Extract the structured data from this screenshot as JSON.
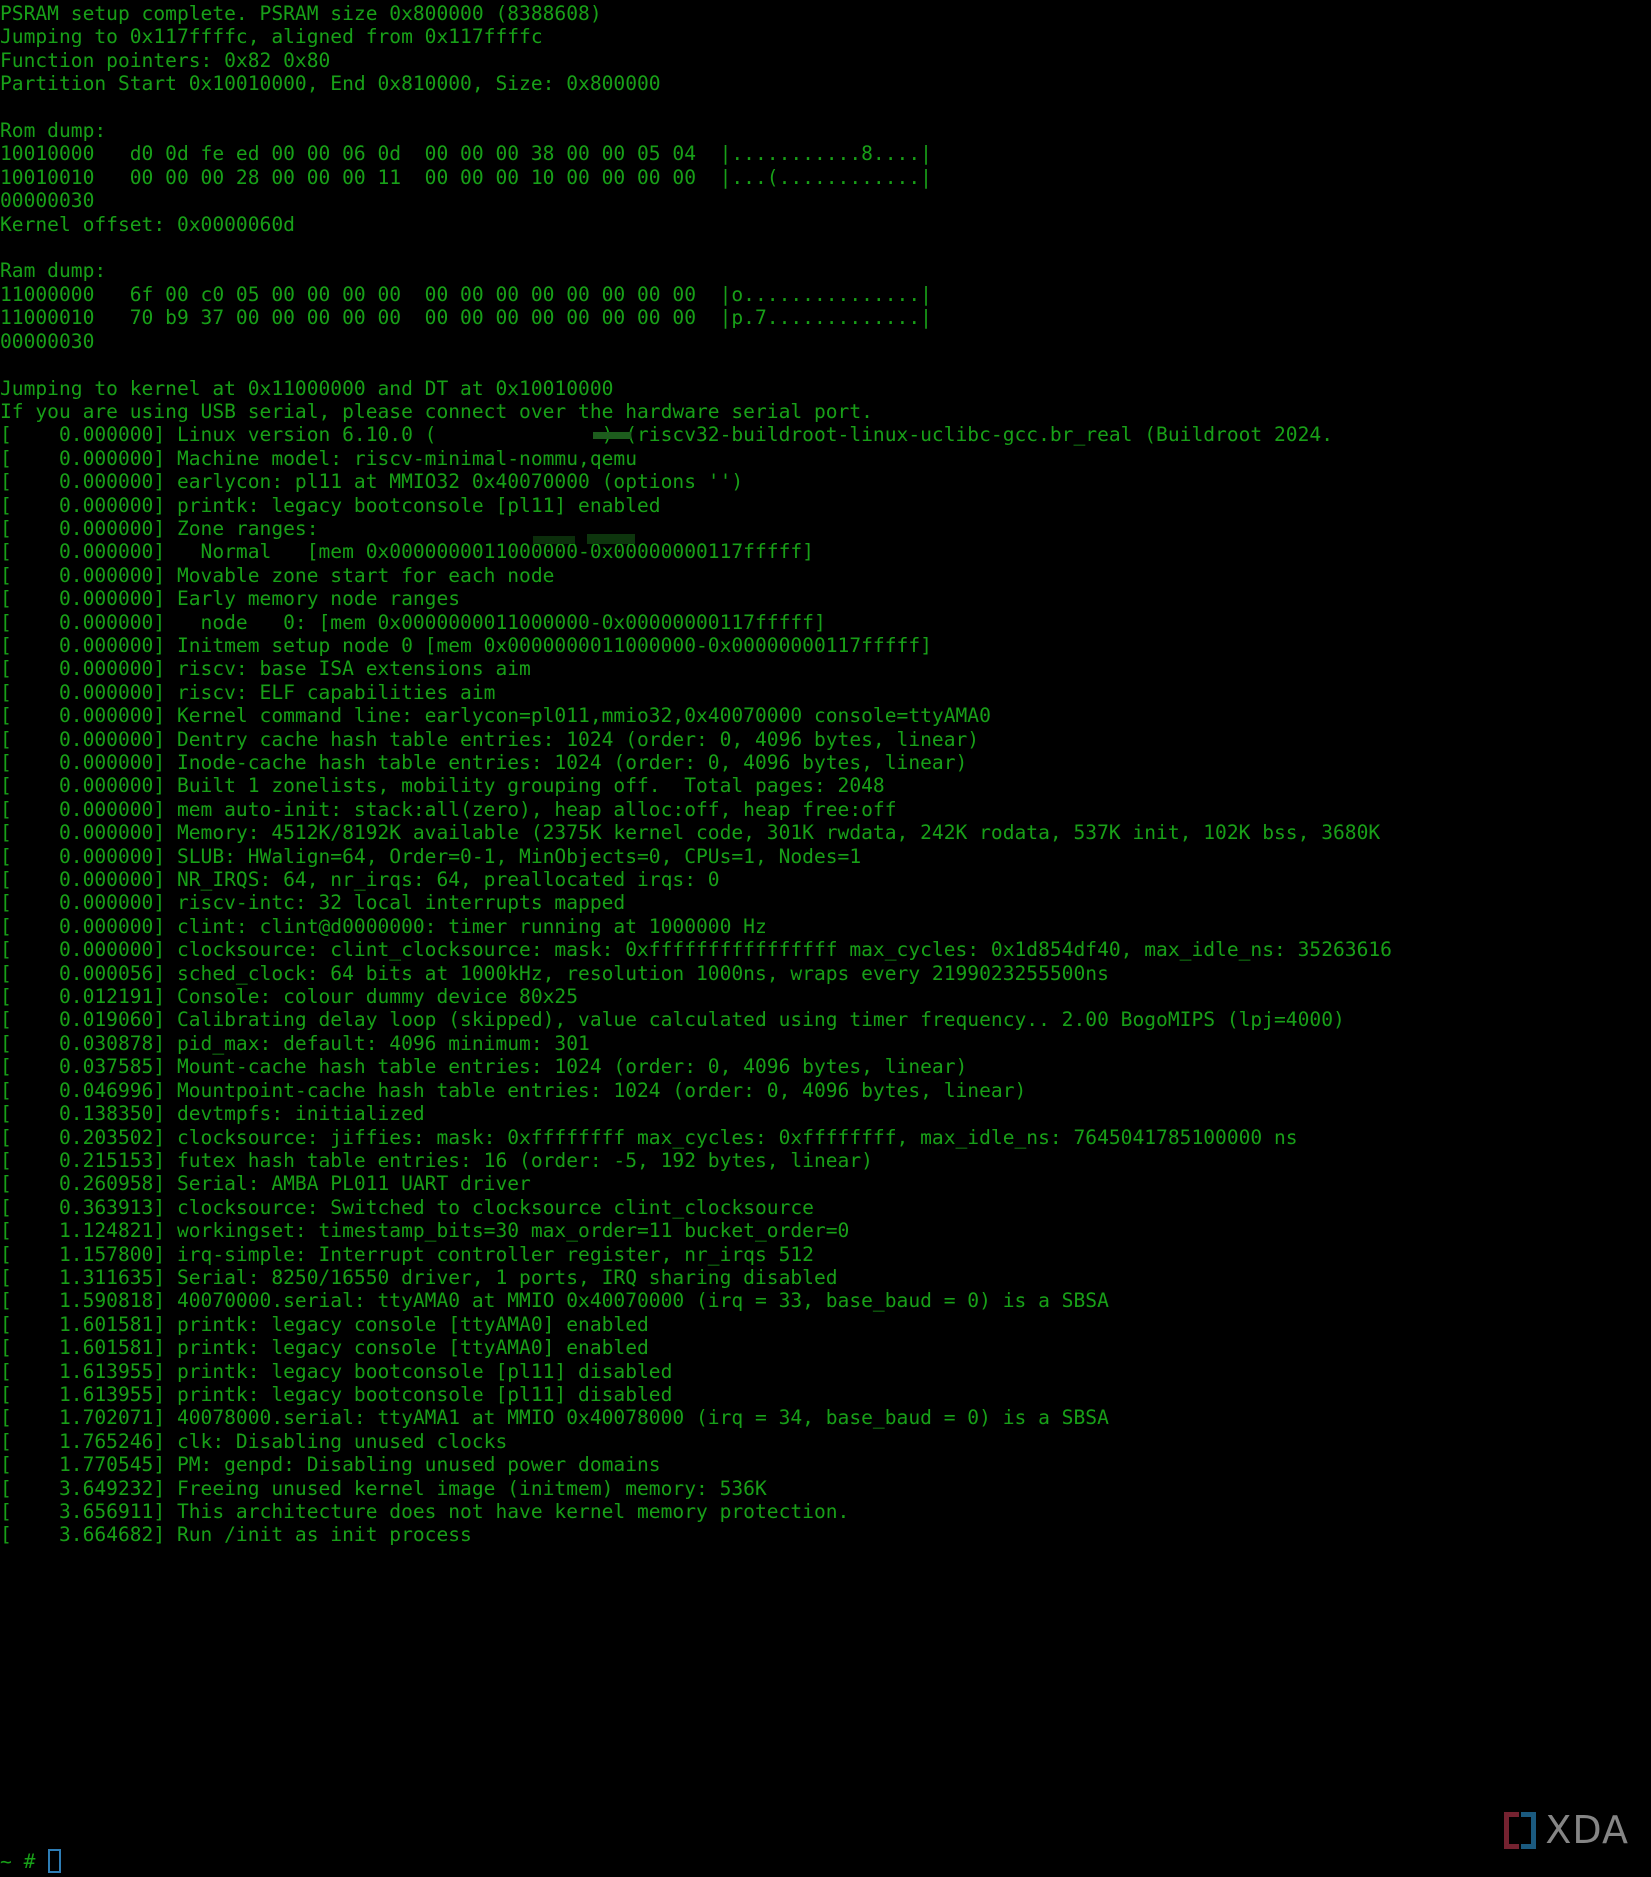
{
  "terminal": {
    "kind": "serial-console",
    "background_color": "#000000",
    "foreground_color": "#18a018",
    "cursor_color": "#2e7db5",
    "font_size_px": 19.6,
    "columns": 84,
    "prompt": "~ # ",
    "cursor_glyph": "block-outline"
  },
  "watermark": {
    "bracket_left": "[",
    "bracket_right": "]",
    "text": "XDA",
    "bracket_left_color": "#7b2433",
    "bracket_right_color": "#1d5f86",
    "text_color": "#8d8d8d"
  },
  "console_lines": [
    "PSRAM setup complete. PSRAM size 0x800000 (8388608)",
    "Jumping to 0x117ffffc, aligned from 0x117ffffc",
    "Function pointers: 0x82 0x80",
    "Partition Start 0x10010000, End 0x810000, Size: 0x800000",
    "",
    "Rom dump:",
    "10010000   d0 0d fe ed 00 00 06 0d  00 00 00 38 00 00 05 04  |...........8....|",
    "10010010   00 00 00 28 00 00 00 11  00 00 00 10 00 00 00 00  |...(............|",
    "00000030",
    "Kernel offset: 0x0000060d",
    "",
    "Ram dump:",
    "11000000   6f 00 c0 05 00 00 00 00  00 00 00 00 00 00 00 00  |o...............|",
    "11000010   70 b9 37 00 00 00 00 00  00 00 00 00 00 00 00 00  |p.7.............|",
    "00000030",
    "",
    "Jumping to kernel at 0x11000000 and DT at 0x10010000",
    "If you are using USB serial, please connect over the hardware serial port.",
    "[    0.000000] Linux version 6.10.0 (              ) (riscv32-buildroot-linux-uclibc-gcc.br_real (Buildroot 2024.",
    "[    0.000000] Machine model: riscv-minimal-nommu,qemu",
    "[    0.000000] earlycon: pl11 at MMIO32 0x40070000 (options '')",
    "[    0.000000] printk: legacy bootconsole [pl11] enabled",
    "[    0.000000] Zone ranges:",
    "[    0.000000]   Normal   [mem 0x0000000011000000-0x00000000117fffff]",
    "[    0.000000] Movable zone start for each node",
    "[    0.000000] Early memory node ranges",
    "[    0.000000]   node   0: [mem 0x0000000011000000-0x00000000117fffff]",
    "[    0.000000] Initmem setup node 0 [mem 0x0000000011000000-0x00000000117fffff]",
    "[    0.000000] riscv: base ISA extensions aim",
    "[    0.000000] riscv: ELF capabilities aim",
    "[    0.000000] Kernel command line: earlycon=pl011,mmio32,0x40070000 console=ttyAMA0",
    "[    0.000000] Dentry cache hash table entries: 1024 (order: 0, 4096 bytes, linear)",
    "[    0.000000] Inode-cache hash table entries: 1024 (order: 0, 4096 bytes, linear)",
    "[    0.000000] Built 1 zonelists, mobility grouping off.  Total pages: 2048",
    "[    0.000000] mem auto-init: stack:all(zero), heap alloc:off, heap free:off",
    "[    0.000000] Memory: 4512K/8192K available (2375K kernel code, 301K rwdata, 242K rodata, 537K init, 102K bss, 3680K",
    "[    0.000000] SLUB: HWalign=64, Order=0-1, MinObjects=0, CPUs=1, Nodes=1",
    "[    0.000000] NR_IRQS: 64, nr_irqs: 64, preallocated irqs: 0",
    "[    0.000000] riscv-intc: 32 local interrupts mapped",
    "[    0.000000] clint: clint@d0000000: timer running at 1000000 Hz",
    "[    0.000000] clocksource: clint_clocksource: mask: 0xffffffffffffffff max_cycles: 0x1d854df40, max_idle_ns: 35263616",
    "[    0.000056] sched_clock: 64 bits at 1000kHz, resolution 1000ns, wraps every 2199023255500ns",
    "[    0.012191] Console: colour dummy device 80x25",
    "[    0.019060] Calibrating delay loop (skipped), value calculated using timer frequency.. 2.00 BogoMIPS (lpj=4000)",
    "[    0.030878] pid_max: default: 4096 minimum: 301",
    "[    0.037585] Mount-cache hash table entries: 1024 (order: 0, 4096 bytes, linear)",
    "[    0.046996] Mountpoint-cache hash table entries: 1024 (order: 0, 4096 bytes, linear)",
    "[    0.138350] devtmpfs: initialized",
    "[    0.203502] clocksource: jiffies: mask: 0xffffffff max_cycles: 0xffffffff, max_idle_ns: 7645041785100000 ns",
    "[    0.215153] futex hash table entries: 16 (order: -5, 192 bytes, linear)",
    "[    0.260958] Serial: AMBA PL011 UART driver",
    "[    0.363913] clocksource: Switched to clocksource clint_clocksource",
    "[    1.124821] workingset: timestamp_bits=30 max_order=11 bucket_order=0",
    "[    1.157800] irq-simple: Interrupt controller register, nr_irqs 512",
    "[    1.311635] Serial: 8250/16550 driver, 1 ports, IRQ sharing disabled",
    "[    1.590818] 40070000.serial: ttyAMA0 at MMIO 0x40070000 (irq = 33, base_baud = 0) is a SBSA",
    "[    1.601581] printk: legacy console [ttyAMA0] enabled",
    "[    1.601581] printk: legacy console [ttyAMA0] enabled",
    "[    1.613955] printk: legacy bootconsole [pl11] disabled",
    "[    1.613955] printk: legacy bootconsole [pl11] disabled",
    "[    1.702071] 40078000.serial: ttyAMA1 at MMIO 0x40078000 (irq = 34, base_baud = 0) is a SBSA",
    "[    1.765246] clk: Disabling unused clocks",
    "[    1.770545] PM: genpd: Disabling unused power domains",
    "[    3.649232] Freeing unused kernel image (initmem) memory: 536K",
    "[    3.656911] This architecture does not have kernel memory protection.",
    "[    3.664682] Run /init as init process"
  ]
}
